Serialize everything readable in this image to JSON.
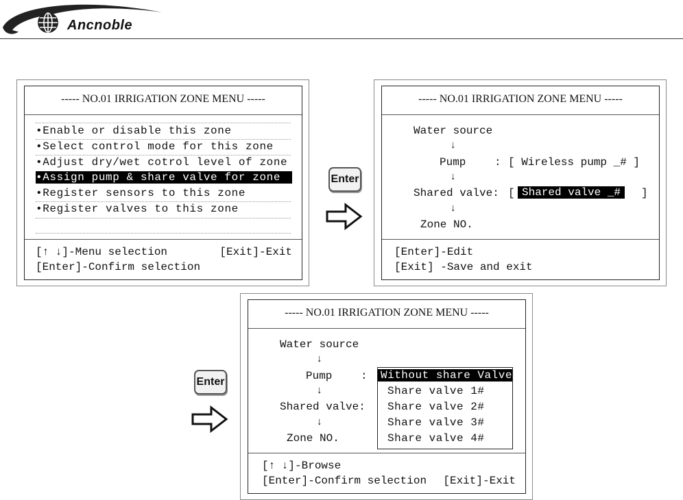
{
  "brand": {
    "name": "Ancnoble"
  },
  "panel_a": {
    "title": "----- NO.01 IRRIGATION ZONE MENU -----",
    "items": [
      "•Enable or disable this zone",
      "•Select control mode for this zone",
      "•Adjust dry/wet cotrol level of zone",
      "•Assign pump & share valve for zone",
      "•Register sensors to this zone",
      "•Register valves to this zone"
    ],
    "selected_index": 3,
    "footer_left_1": "[↑ ↓]-Menu selection",
    "footer_right_1": "[Exit]-Exit",
    "footer_left_2": "[Enter]-Confirm selection"
  },
  "panel_b": {
    "title": "----- NO.01 IRRIGATION ZONE MENU -----",
    "water_source": "Water source",
    "pump_label": "Pump",
    "pump_colon": ":",
    "pump_value": "[ Wireless pump _#  ]",
    "shared_label": "Shared valve:",
    "shared_open": "[",
    "shared_value": "Shared valve _#",
    "shared_close": "]",
    "zone_label": "Zone NO.",
    "footer_1": "[Enter]-Edit",
    "footer_2": "[Exit] -Save and exit"
  },
  "panel_c": {
    "title": "----- NO.01 IRRIGATION ZONE MENU -----",
    "water_source": "Water source",
    "pump_label": "Pump",
    "pump_colon": ":",
    "shared_label": "Shared valve:",
    "zone_label": "Zone NO.",
    "options": [
      "Without share Valve",
      "Share valve 1#",
      "Share valve 2#",
      "Share valve 3#",
      "Share valve 4#"
    ],
    "selected_index": 0,
    "footer_1": "[↑ ↓]-Browse",
    "footer_left_2": "[Enter]-Confirm selection",
    "footer_right_2": "[Exit]-Exit"
  },
  "keys": {
    "enter_label": "Enter"
  },
  "glyphs": {
    "down_arrow": "↓"
  },
  "icons": {
    "logo": "globe-logo-icon",
    "next": "hollow-right-arrow-icon"
  },
  "colors": {
    "highlight": "#000000",
    "highlight_text": "#ffffff"
  }
}
